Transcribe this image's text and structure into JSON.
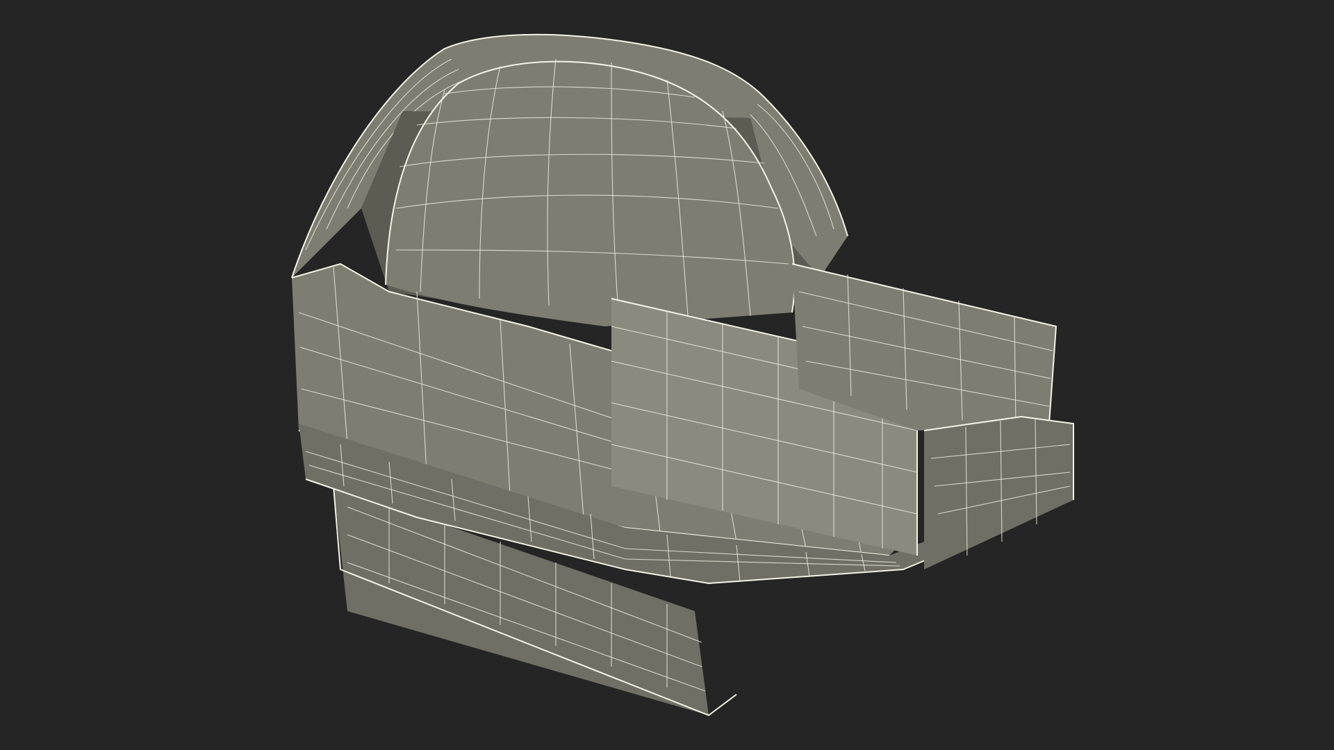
{
  "scene": {
    "subject": "wireframe-3d-model",
    "colors": {
      "background": "#252525",
      "surface": "#7d7d72",
      "wireframe": "#eaeadb"
    }
  }
}
